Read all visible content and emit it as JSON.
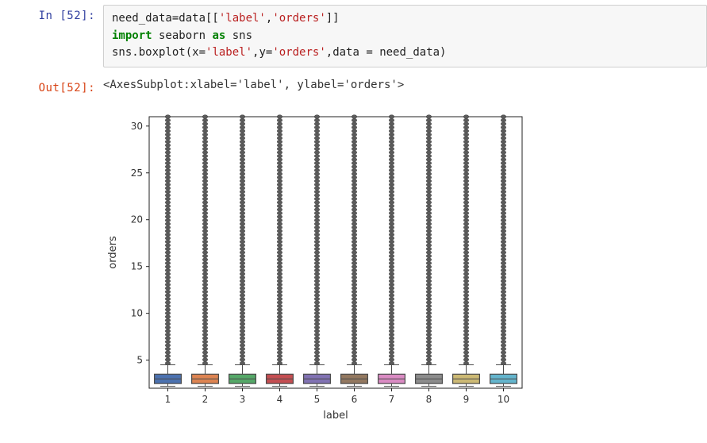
{
  "input_prompt": "In  [52]:",
  "output_prompt": "Out[52]:",
  "code_line1_pre": "need_data=data[[",
  "code_line1_s1": "'label'",
  "code_line1_mid": ",",
  "code_line1_s2": "'orders'",
  "code_line1_post": "]]",
  "code_line2_kw1": "import",
  "code_line2_id1": " seaborn ",
  "code_line2_kw2": "as",
  "code_line2_id2": " sns",
  "code_line3_pre": "sns.boxplot(x=",
  "code_line3_s1": "'label'",
  "code_line3_mid1": ",y=",
  "code_line3_s2": "'orders'",
  "code_line3_mid2": ",data = need_data)",
  "output_text": "<AxesSubplot:xlabel='label', ylabel='orders'>",
  "chart_data": {
    "type": "boxplot",
    "xlabel": "label",
    "ylabel": "orders",
    "xticks": [
      "1",
      "2",
      "3",
      "4",
      "5",
      "6",
      "7",
      "8",
      "9",
      "10"
    ],
    "yticks": [
      5,
      10,
      15,
      20,
      25,
      30
    ],
    "ylim": [
      2,
      31
    ],
    "series": [
      {
        "category": "1",
        "q1": 2.5,
        "median": 3,
        "q3": 3.5,
        "whisker_low": 2.2,
        "whisker_high": 4.5,
        "outlier_top": 31,
        "color": "#4C72B0"
      },
      {
        "category": "2",
        "q1": 2.5,
        "median": 3,
        "q3": 3.5,
        "whisker_low": 2.2,
        "whisker_high": 4.5,
        "outlier_top": 31,
        "color": "#DD8452"
      },
      {
        "category": "3",
        "q1": 2.5,
        "median": 3,
        "q3": 3.5,
        "whisker_low": 2.2,
        "whisker_high": 4.5,
        "outlier_top": 31,
        "color": "#55A868"
      },
      {
        "category": "4",
        "q1": 2.5,
        "median": 3,
        "q3": 3.5,
        "whisker_low": 2.2,
        "whisker_high": 4.5,
        "outlier_top": 31,
        "color": "#C44E52"
      },
      {
        "category": "5",
        "q1": 2.5,
        "median": 3,
        "q3": 3.5,
        "whisker_low": 2.2,
        "whisker_high": 4.5,
        "outlier_top": 31,
        "color": "#8172B3"
      },
      {
        "category": "6",
        "q1": 2.5,
        "median": 3,
        "q3": 3.5,
        "whisker_low": 2.2,
        "whisker_high": 4.5,
        "outlier_top": 31,
        "color": "#937860"
      },
      {
        "category": "7",
        "q1": 2.5,
        "median": 3,
        "q3": 3.5,
        "whisker_low": 2.2,
        "whisker_high": 4.5,
        "outlier_top": 31,
        "color": "#DA8BC3"
      },
      {
        "category": "8",
        "q1": 2.5,
        "median": 3,
        "q3": 3.5,
        "whisker_low": 2.2,
        "whisker_high": 4.5,
        "outlier_top": 31,
        "color": "#8C8C8C"
      },
      {
        "category": "9",
        "q1": 2.5,
        "median": 3,
        "q3": 3.5,
        "whisker_low": 2.2,
        "whisker_high": 4.5,
        "outlier_top": 31,
        "color": "#CCB974"
      },
      {
        "category": "10",
        "q1": 2.5,
        "median": 3,
        "q3": 3.5,
        "whisker_low": 2.2,
        "whisker_high": 4.5,
        "outlier_top": 31,
        "color": "#64B5CD"
      }
    ]
  }
}
